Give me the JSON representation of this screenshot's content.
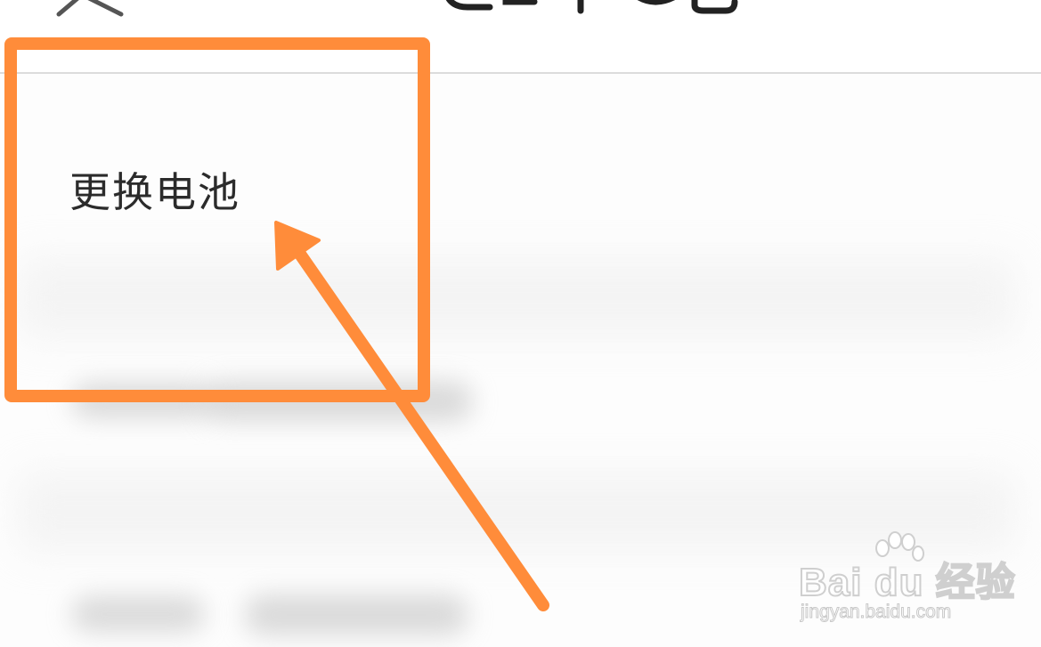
{
  "screen": {
    "menu": {
      "items": [
        {
          "label": "更换电池"
        }
      ]
    },
    "icons": {
      "back": "chevron-left-icon"
    }
  },
  "annotations": {
    "highlight_color": "#ff8c3a",
    "arrow_color": "#ff8c3a"
  },
  "watermark": {
    "brand": "Bai du 经验",
    "url": "jingyan.baidu.com"
  },
  "colors": {
    "background": "#fdfdfd",
    "text": "#2b2b2b",
    "divider": "#dcdcdc"
  }
}
